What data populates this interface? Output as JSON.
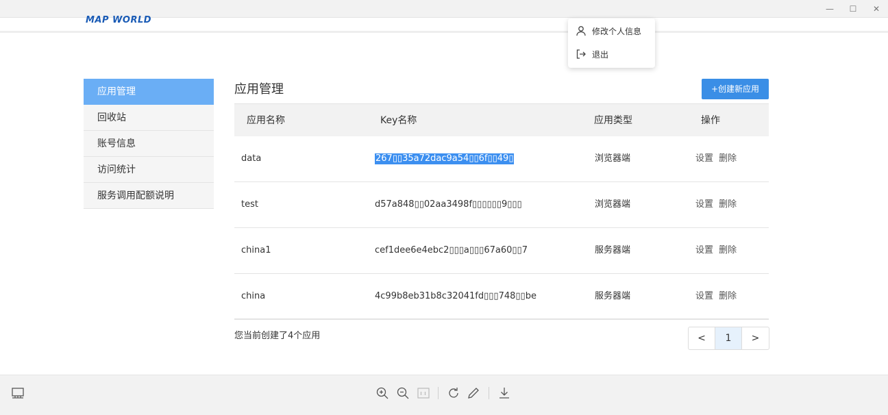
{
  "window": {
    "controls": [
      "minimize-icon",
      "maximize-icon",
      "close-icon"
    ],
    "minimize_glyph": "—",
    "maximize_glyph": "☐",
    "close_glyph": "✕"
  },
  "logo": {
    "text": "MAP WORLD"
  },
  "user_menu": {
    "items": [
      {
        "label": "修改个人信息",
        "icon": "user-icon"
      },
      {
        "label": "退出",
        "icon": "logout-icon"
      }
    ]
  },
  "sidebar": {
    "items": [
      {
        "label": "应用管理",
        "active": true
      },
      {
        "label": "回收站"
      },
      {
        "label": "账号信息"
      },
      {
        "label": "访问统计"
      },
      {
        "label": "服务调用配额说明"
      }
    ]
  },
  "main": {
    "title": "应用管理",
    "create_button": "+创建新应用",
    "table": {
      "headers": [
        "应用名称",
        "Key名称",
        "应用类型",
        "操作"
      ],
      "rows": [
        {
          "name": "data",
          "key": "267▯▯35a72dac9a54▯▯6f▯▯49▯",
          "type": "浏览器端",
          "actions": [
            "设置",
            "删除"
          ]
        },
        {
          "name": "test",
          "key": "d57a848▯▯02aa3498f▯▯▯▯▯▯9▯▯▯",
          "type": "浏览器端",
          "actions": [
            "设置",
            "删除"
          ]
        },
        {
          "name": "china1",
          "key": "cef1dee6e4ebc2▯▯▯a▯▯▯67a60▯▯7",
          "type": "服务器端",
          "actions": [
            "设置",
            "删除"
          ]
        },
        {
          "name": "china",
          "key": "4c99b8eb31b8c32041fd▯▯▯748▯▯be",
          "type": "服务器端",
          "actions": [
            "设置",
            "删除"
          ]
        }
      ]
    },
    "summary": "您当前创建了4个应用",
    "pagination": {
      "prev": "<",
      "current": "1",
      "next": ">"
    }
  },
  "toolbar": {
    "left_icon": "layout-icon",
    "icons": [
      "zoom-in-icon",
      "zoom-out-icon",
      "actual-size-icon",
      "rotate-icon",
      "edit-icon",
      "download-icon"
    ]
  }
}
